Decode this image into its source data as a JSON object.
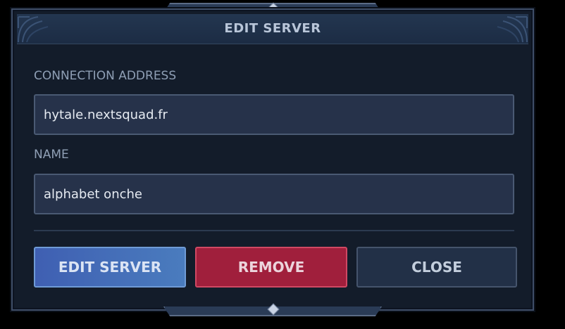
{
  "dialog": {
    "title": "EDIT SERVER"
  },
  "fields": {
    "address": {
      "label": "CONNECTION ADDRESS",
      "value": "hytale.nextsquad.fr"
    },
    "name": {
      "label": "NAME",
      "value": "alphabet onche"
    }
  },
  "buttons": {
    "edit_label": "EDIT SERVER",
    "remove_label": "REMOVE",
    "close_label": "CLOSE"
  },
  "colors": {
    "edit_button": "#4a6cb8",
    "remove_button": "#a01f3c",
    "close_button": "#223047",
    "modal_background": "#131c2a"
  }
}
